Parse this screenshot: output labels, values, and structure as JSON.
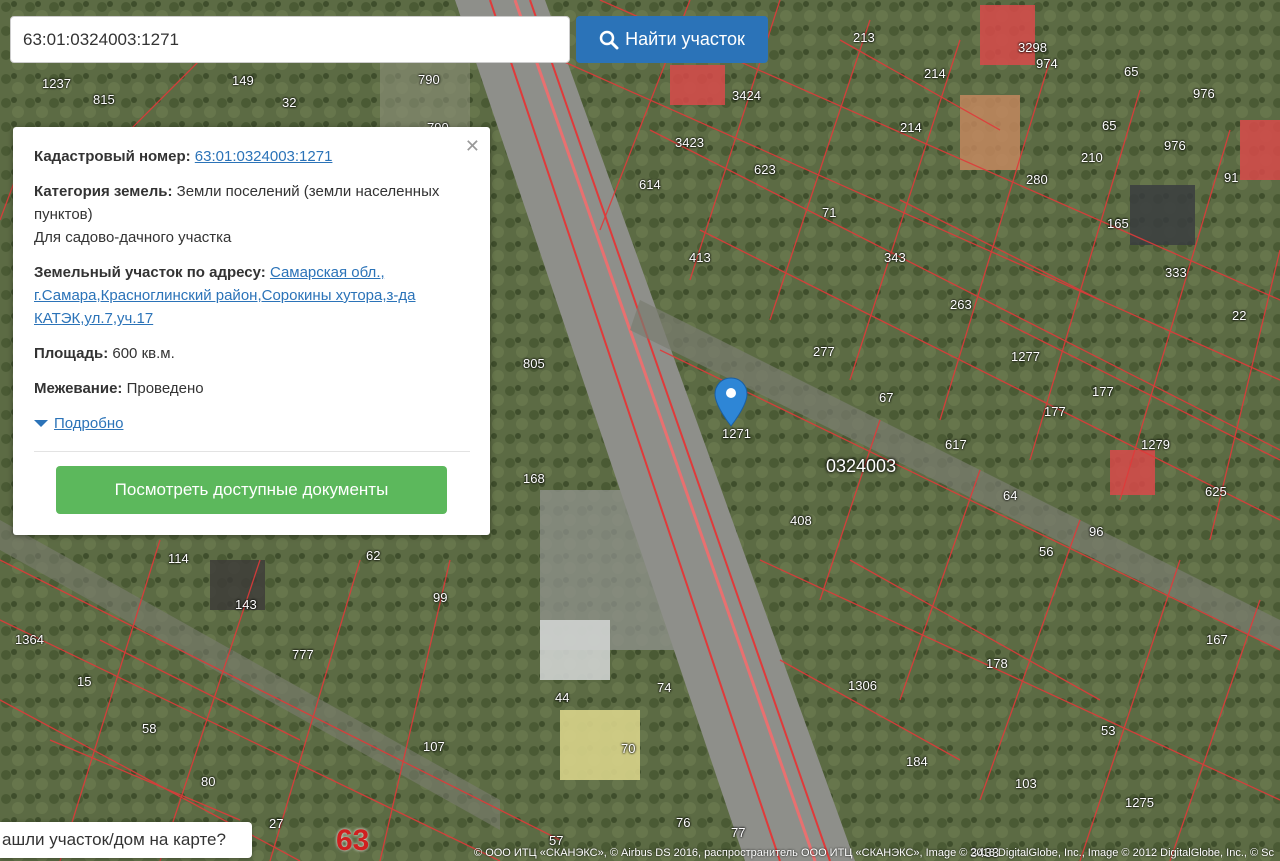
{
  "search": {
    "value": "63:01:0324003:1271",
    "button_label": "Найти участок"
  },
  "popup": {
    "cadastral_label": "Кадастровый номер:",
    "cadastral_value": "63:01:0324003:1271",
    "category_label": "Категория земель:",
    "category_value": "Земли поселений (земли населенных пунктов)",
    "use_value": "Для садово-дачного участка",
    "address_label": "Земельный участок по адресу:",
    "address_value": "Самарская обл., г.Самара,Красноглинский район,Сорокины хутора,з-да КАТЭК,ул.7,уч.17",
    "area_label": "Площадь:",
    "area_value": "600 кв.м.",
    "survey_label": "Межевание:",
    "survey_value": "Проведено",
    "more_label": "Подробно",
    "docs_button": "Посмотреть доступные документы"
  },
  "bottom_prompt": "ашли участок/дом на карте?",
  "attribution": "© ООО ИТЦ «СКАНЭКС», © Airbus DS 2016, распространитель ООО ИТЦ «СКАНЭКС», Image © 2018 DigitalGlobe, Inc., Image © 2012 DigitalGlobe, Inc., © Sc",
  "map": {
    "quarter_label": "0324003",
    "marker_parcel": "1271",
    "parcel_labels": [
      "1237",
      "815",
      "149",
      "32",
      "790",
      "790",
      "213",
      "214",
      "214",
      "3298",
      "974",
      "65",
      "976",
      "976",
      "65",
      "3424",
      "3423",
      "623",
      "614",
      "71",
      "413",
      "343",
      "263",
      "280",
      "210",
      "165",
      "333",
      "22",
      "91",
      "805",
      "277",
      "1277",
      "177",
      "177",
      "67",
      "617",
      "1279",
      "168",
      "408",
      "64",
      "625",
      "96",
      "56",
      "114",
      "62",
      "143",
      "99",
      "777",
      "1364",
      "15",
      "58",
      "80",
      "44",
      "74",
      "70",
      "107",
      "1306",
      "178",
      "53",
      "167",
      "184",
      "103",
      "1275",
      "27",
      "57",
      "76",
      "77",
      "63",
      "3433"
    ]
  },
  "colors": {
    "accent": "#2b73b8",
    "success": "#5cb85c",
    "parcel_lines": "#e03a3a",
    "marker": "#2e86d6"
  }
}
